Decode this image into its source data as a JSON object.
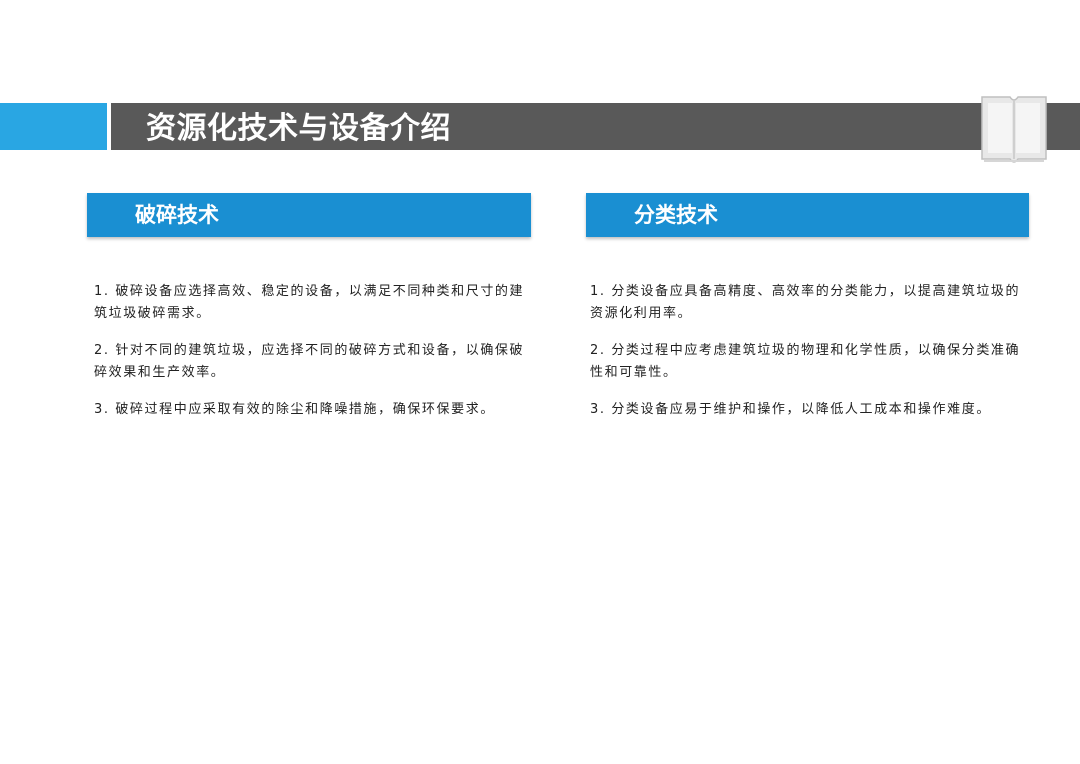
{
  "page": {
    "title": "资源化技术与设备介绍"
  },
  "colors": {
    "accent_blue": "#29a6e3",
    "header_blue": "#1a8fd2",
    "title_gray": "#595959"
  },
  "icons": {
    "title_decoration": "book-icon"
  },
  "sections": [
    {
      "title": "破碎技术",
      "items": [
        "1. 破碎设备应选择高效、稳定的设备，以满足不同种类和尺寸的建筑垃圾破碎需求。",
        "2. 针对不同的建筑垃圾，应选择不同的破碎方式和设备，以确保破碎效果和生产效率。",
        "3. 破碎过程中应采取有效的除尘和降噪措施，确保环保要求。"
      ]
    },
    {
      "title": "分类技术",
      "items": [
        "1. 分类设备应具备高精度、高效率的分类能力，以提高建筑垃圾的资源化利用率。",
        "2. 分类过程中应考虑建筑垃圾的物理和化学性质，以确保分类准确性和可靠性。",
        "3. 分类设备应易于维护和操作，以降低人工成本和操作难度。"
      ]
    }
  ]
}
